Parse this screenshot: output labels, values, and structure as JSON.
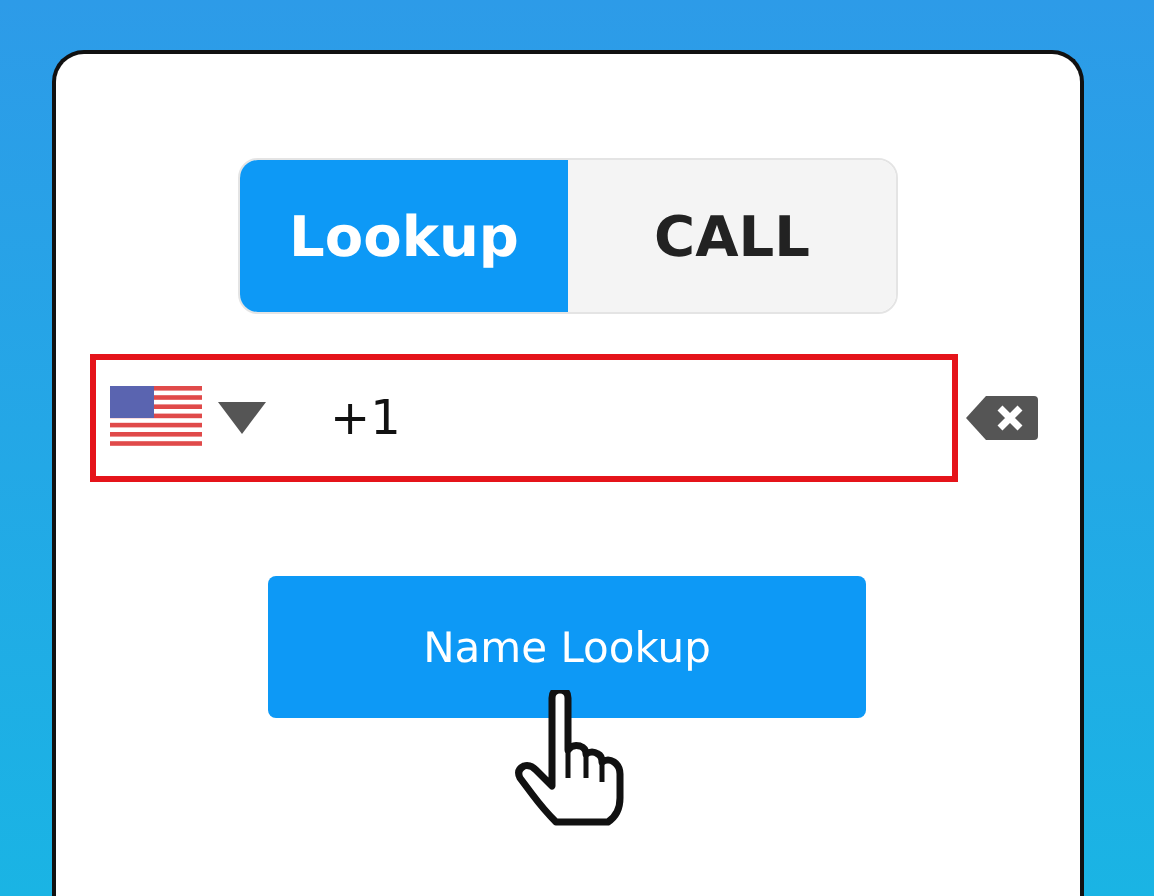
{
  "tabs": [
    {
      "label": "Lookup",
      "selected": true
    },
    {
      "label": "CALL",
      "selected": false
    }
  ],
  "phone_field": {
    "value": "+1",
    "highlighted": true
  },
  "button": {
    "label": "Name Lookup"
  }
}
